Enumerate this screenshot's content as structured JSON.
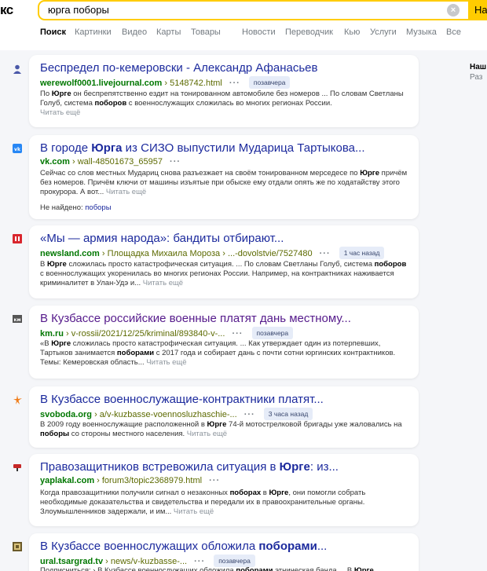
{
  "header": {
    "logo": "кс",
    "query": "юрга поборы",
    "find_label": "На"
  },
  "tabs": [
    "Поиск",
    "Картинки",
    "Видео",
    "Карты",
    "Товары",
    "Новости",
    "Переводчик",
    "Кью",
    "Услуги",
    "Музыка",
    "Все"
  ],
  "sidebar": {
    "title": "Наш",
    "subtitle": "Раз"
  },
  "results": [
    {
      "title": "Беспредел по-кемеровски - Александр Афанасьев",
      "domain": "werewolf0001.livejournal.com",
      "path": "› 5148742.html",
      "badge": "позавчера",
      "snippet_html": "По <b>Юрге</b> он беспрепятственно ездит на тонированном автомобиле без номеров ... По словам Светланы Голуб, система <b>поборов</b> с военнослужащих сложилась во многих регионах России.",
      "more": "Читать ещё",
      "favicon_color": "#4a58a8",
      "favicon_icon": "person-icon"
    },
    {
      "title": "В городе Юрга из СИЗО выпустили Мударица Тартыкова...",
      "domain": "vk.com",
      "path": "› wall-48501673_65957",
      "badge": "",
      "snippet_html": "Сейчас со слов местных Мудариц снова разъезжает на своём тонированном мерседесе по <b>Юрге</b> причём без номеров. Причём ключи от машины изъятые при обыске ему отдали опять же по ходатайству этого прокурора. А вот...",
      "more": "Читать ещё",
      "notfound_label": "Не найдено:",
      "notfound_word": "поборы",
      "favicon_color": "#2787f5",
      "favicon_icon": "vk-icon"
    },
    {
      "title": "«Мы — армия народа»: бандиты отбирают...",
      "domain": "newsland.com",
      "path": "› Площадка Михаила Мороза › ...-dovolstvie/7527480",
      "badge": "1 час назад",
      "snippet_html": "В <b>Юрге</b> сложилась просто катастрофическая ситуация. ... По словам Светланы Голуб, система <b>поборов</b> с военнослужащих укоренилась во многих регионах России. Например, на контрактниках наживается криминалитет в Улан-Удэ и...",
      "more": "Читать ещё",
      "favicon_color": "#d9262e",
      "favicon_icon": "newsland-icon"
    },
    {
      "title": "В Кузбассе российские военные платят дань местному...",
      "domain": "km.ru",
      "path": "› v-rossii/2021/12/25/kriminal/893840-v-...",
      "badge": "позавчера",
      "snippet_html": "«В <b>Юрге</b> сложилась просто катастрофическая ситуация. ... Как утверждает один из потерпевших, Тартыков занимается <b>поборами</b> с 2017 года и собирает дань с почти сотни юргинских контрактников. Темы: Кемеровская область...",
      "more": "Читать ещё",
      "favicon_color": "#555555",
      "favicon_icon": "km-icon"
    },
    {
      "title": "В Кузбассе военнослужащие-контрактники платят...",
      "domain": "svoboda.org",
      "path": "› a/v-kuzbasse-voennosluzhaschie-...",
      "badge": "3 часа назад",
      "snippet_html": "В 2009 году военнослужащие расположенной в <b>Юрге</b> 74-й мотострелковой бригады уже жаловались на <b>поборы</b> со стороны местного населения.",
      "more": "Читать ещё",
      "favicon_color": "#f07d1a",
      "favicon_icon": "svoboda-icon"
    },
    {
      "title": "Правозащитников встревожила ситуация в Юрге: из...",
      "domain": "yaplakal.com",
      "path": "› forum3/topic2368979.html",
      "badge": "",
      "snippet_html": "Когда правозащитники получили сигнал о незаконных <b>поборах</b> в <b>Юрге</b>, они помогли собрать необходимые доказательства и свидетельства и передали их в правоохранительные органы. Злоумышленников задержали, и им...",
      "more": "Читать ещё",
      "favicon_color": "#c62828",
      "favicon_icon": "yaplakal-icon"
    },
    {
      "title": "В Кузбассе военнослужащих обложила поборами...",
      "domain": "ural.tsargrad.tv",
      "path": "› news/v-kuzbasse-...",
      "badge": "позавчера",
      "snippet_html": "Подписчиться: › В Кузбассе военнослужащих обложила <b>поборами</b> этническая банда ... В <b>Юрге</b>",
      "more": "",
      "favicon_color": "#6b5a2a",
      "favicon_icon": "tsargrad-icon"
    }
  ]
}
